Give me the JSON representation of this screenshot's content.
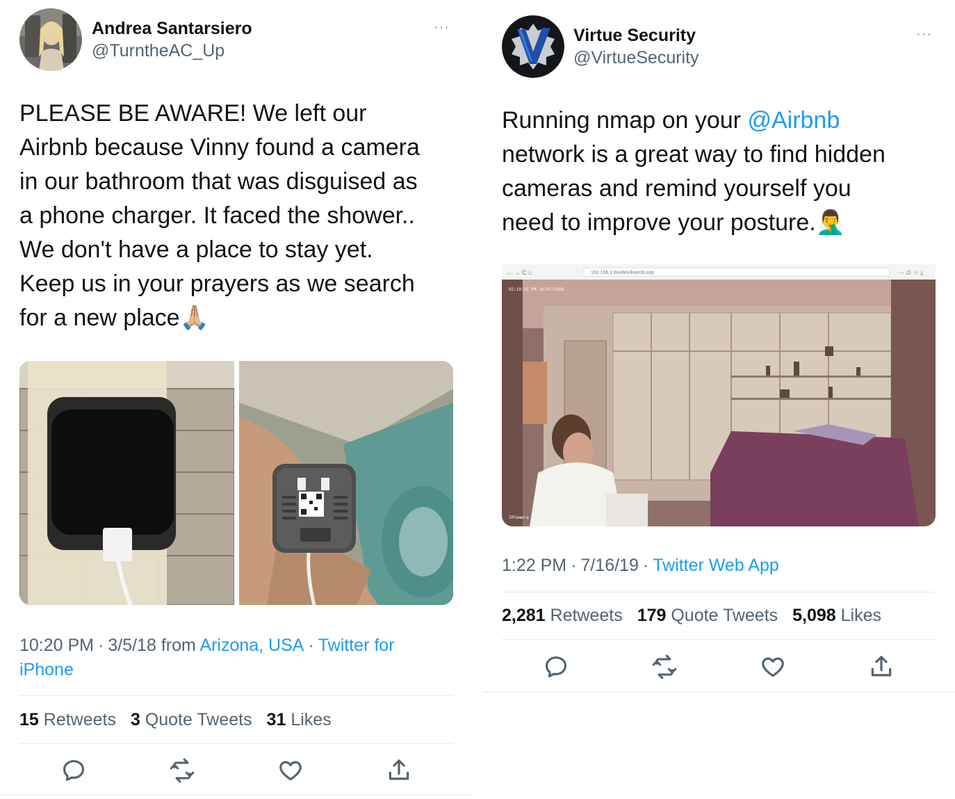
{
  "left_tweet": {
    "author": {
      "name": "Andrea Santarsiero",
      "handle": "@TurntheAC_Up"
    },
    "more_label": "···",
    "text_lines": [
      "PLEASE BE AWARE! We left our",
      "Airbnb because Vinny found a camera",
      "in our bathroom that was disguised as",
      "a phone charger. It faced the shower..",
      "We don't have a place to stay yet.",
      "Keep us in your prayers as we search",
      "for a new place🙏🏼"
    ],
    "meta": {
      "time": "10:20 PM",
      "sep1": "·",
      "date": "3/5/18",
      "from_label": "from",
      "location": "Arizona, USA",
      "sep2": "·",
      "source_line1": "Twitter for",
      "source_line2": "iPhone"
    },
    "stats": {
      "retweets_count": "15",
      "retweets_label": "Retweets",
      "quotes_count": "3",
      "quotes_label": "Quote Tweets",
      "likes_count": "31",
      "likes_label": "Likes"
    },
    "actions": [
      "reply-icon",
      "retweet-icon",
      "like-icon",
      "share-icon"
    ]
  },
  "right_tweet": {
    "author": {
      "name": "Virtue Security",
      "handle": "@VirtueSecurity"
    },
    "more_label": "···",
    "text": {
      "line1_prefix": "Running nmap on your ",
      "line1_mention": "@Airbnb",
      "line2": "network is a great way to find hidden",
      "line3": "cameras and remind yourself you",
      "line4": "need to improve your posture.🤦‍♂️"
    },
    "screenshot": {
      "url_text": "192.168.1.8/video/livemb.asp",
      "overlay_timestamp": "02:18:02 PM 16/07/2019",
      "overlay_camera": "IPCamera"
    },
    "meta": {
      "time": "1:22 PM",
      "sep1": "·",
      "date": "7/16/19",
      "sep2": "·",
      "source": "Twitter Web App"
    },
    "stats": {
      "retweets_count": "2,281",
      "retweets_label": "Retweets",
      "quotes_count": "179",
      "quotes_label": "Quote Tweets",
      "likes_count": "5,098",
      "likes_label": "Likes"
    },
    "actions": [
      "reply-icon",
      "retweet-icon",
      "like-icon",
      "share-icon"
    ]
  },
  "colors": {
    "link": "#1d9bf0",
    "secondary_text": "#536471",
    "primary_text": "#0f1419",
    "divider": "#e6e9ea"
  }
}
